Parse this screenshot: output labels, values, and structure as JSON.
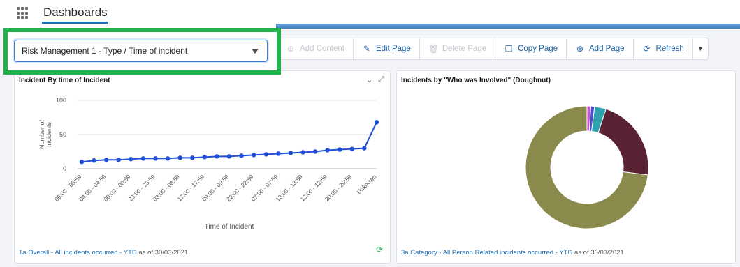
{
  "header": {
    "app_title": "Dashboards"
  },
  "selector": {
    "value": "Risk Management 1 - Type / Time of incident"
  },
  "toolbar": {
    "add_content": "Add Content",
    "edit_page": "Edit Page",
    "delete_page": "Delete Page",
    "copy_page": "Copy Page",
    "add_page": "Add Page",
    "refresh": "Refresh"
  },
  "colors": {
    "brand": "#1b6fb8",
    "highlight_box": "#22b14c",
    "line_series": "#1f4fd6"
  },
  "chart_left": {
    "title": "Incident By time of Incident",
    "footer_link": "1a Overall - All incidents occurred - YTD",
    "footer_suffix": "as of 30/03/2021"
  },
  "chart_right": {
    "title": "Incidents by \"Who was Involved\" (Doughnut)",
    "footer_link": "3a Category - All Person Related incidents occurred - YTD",
    "footer_suffix": "as of 30/03/2021"
  },
  "chart_data": [
    {
      "type": "line",
      "title": "Incident By time of Incident",
      "xlabel": "Time of Incident",
      "ylabel": "Number of Incidents",
      "ylim": [
        0,
        100
      ],
      "yticks": [
        0,
        50,
        100
      ],
      "categories": [
        "06:00 - 06:59",
        "",
        "04:00 - 04:59",
        "",
        "00:00 - 00:59",
        "",
        "23:00 - 23:59",
        "",
        "08:00 - 08:59",
        "",
        "17:00 - 17:59",
        "",
        "09:00 - 09:59",
        "",
        "22:00 - 22:59",
        "",
        "07:00 - 07:59",
        "",
        "13:00 - 13:59",
        "",
        "12:00 - 12:59",
        "",
        "20:00 - 20:59",
        "",
        "Unknown"
      ],
      "values": [
        10,
        12,
        13,
        13,
        14,
        15,
        15,
        15,
        16,
        16,
        17,
        18,
        18,
        19,
        20,
        21,
        22,
        23,
        24,
        25,
        27,
        28,
        29,
        30,
        68
      ],
      "grid": true
    },
    {
      "type": "pie",
      "title": "Incidents by \"Who was Involved\" (Doughnut)",
      "categories": [
        "",
        "",
        "",
        "",
        ""
      ],
      "values": [
        1,
        1,
        3,
        22,
        73
      ],
      "colors": [
        "#c94fd8",
        "#4b4fd0",
        "#2fa3ad",
        "#5a2333",
        "#8b8a4d"
      ]
    }
  ]
}
